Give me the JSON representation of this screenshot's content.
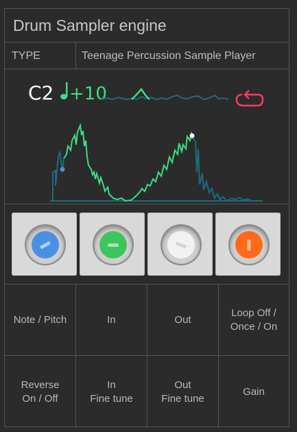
{
  "title": "Drum Sampler engine",
  "type_row": {
    "label": "TYPE",
    "value": "Teenage Percussion Sample Player"
  },
  "display": {
    "note": "C2",
    "tune": "+10",
    "colors": {
      "note": "#ffffff",
      "tune": "#3ddc84",
      "wave": "#1e6b7d",
      "wave_active": "#3ddc84",
      "loop": "#ff3b5c",
      "marker_in": "#4a90e2",
      "marker_out": "#ffffff"
    }
  },
  "knobs": [
    {
      "name": "blue",
      "color": "#4a90e2"
    },
    {
      "name": "green",
      "color": "#3ec45a"
    },
    {
      "name": "white",
      "color": "#f2f2f2"
    },
    {
      "name": "orange",
      "color": "#ff6a1a"
    }
  ],
  "labels_row1": [
    "Note / Pitch",
    "In",
    "Out",
    "Loop Off / Once / On"
  ],
  "labels_row2": [
    "Reverse On / Off",
    "In Fine tune",
    "Out Fine tune",
    "Gain"
  ]
}
